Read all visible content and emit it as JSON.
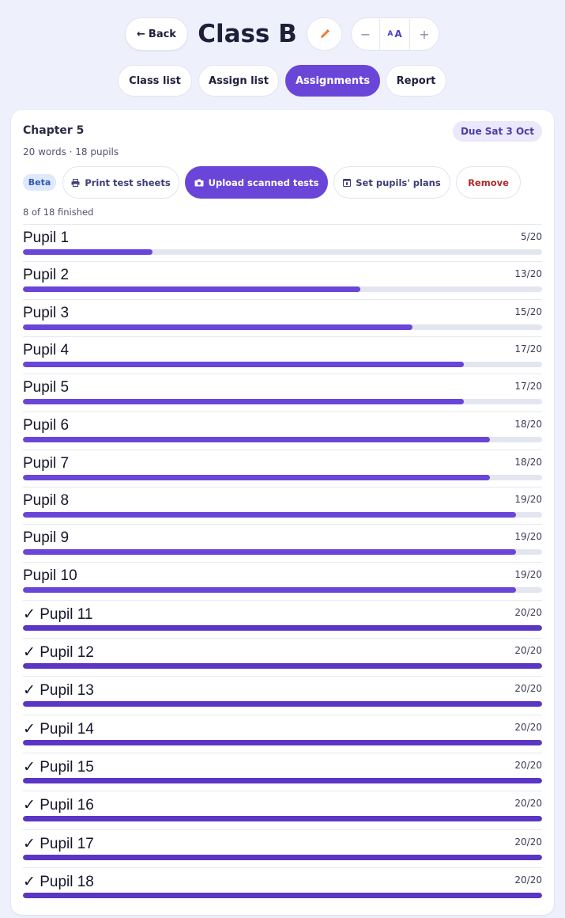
{
  "header": {
    "back_label": "Back",
    "back_arrow": "←",
    "title": "Class B",
    "edit_icon": "pencil-icon",
    "font_size_minus": "−",
    "font_size_small_a": "A",
    "font_size_big_a": "A",
    "font_size_plus": "+"
  },
  "tabs": [
    {
      "label": "Class list",
      "active": false
    },
    {
      "label": "Assign list",
      "active": false
    },
    {
      "label": "Assignments",
      "active": true
    },
    {
      "label": "Report",
      "active": false
    }
  ],
  "assignment": {
    "title": "Chapter 5",
    "due": "Due Sat 3 Oct",
    "meta": "20 words · 18 pupils",
    "beta_label": "Beta",
    "actions": {
      "print": "Print test sheets",
      "upload": "Upload scanned tests",
      "plans": "Set pupils' plans",
      "remove": "Remove"
    },
    "finished": "8 of 18 finished"
  },
  "pupils": [
    {
      "name": "Pupil 1",
      "score": "5/20",
      "correct": 5,
      "total": 20,
      "done": false
    },
    {
      "name": "Pupil 2",
      "score": "13/20",
      "correct": 13,
      "total": 20,
      "done": false
    },
    {
      "name": "Pupil 3",
      "score": "15/20",
      "correct": 15,
      "total": 20,
      "done": false
    },
    {
      "name": "Pupil 4",
      "score": "17/20",
      "correct": 17,
      "total": 20,
      "done": false
    },
    {
      "name": "Pupil 5",
      "score": "17/20",
      "correct": 17,
      "total": 20,
      "done": false
    },
    {
      "name": "Pupil 6",
      "score": "18/20",
      "correct": 18,
      "total": 20,
      "done": false
    },
    {
      "name": "Pupil 7",
      "score": "18/20",
      "correct": 18,
      "total": 20,
      "done": false
    },
    {
      "name": "Pupil 8",
      "score": "19/20",
      "correct": 19,
      "total": 20,
      "done": false
    },
    {
      "name": "Pupil 9",
      "score": "19/20",
      "correct": 19,
      "total": 20,
      "done": false
    },
    {
      "name": "Pupil 10",
      "score": "19/20",
      "correct": 19,
      "total": 20,
      "done": false
    },
    {
      "name": "✓ Pupil 11",
      "score": "20/20",
      "correct": 20,
      "total": 20,
      "done": true
    },
    {
      "name": "✓ Pupil 12",
      "score": "20/20",
      "correct": 20,
      "total": 20,
      "done": true
    },
    {
      "name": "✓ Pupil 13",
      "score": "20/20",
      "correct": 20,
      "total": 20,
      "done": true
    },
    {
      "name": "✓ Pupil 14",
      "score": "20/20",
      "correct": 20,
      "total": 20,
      "done": true
    },
    {
      "name": "✓ Pupil 15",
      "score": "20/20",
      "correct": 20,
      "total": 20,
      "done": true
    },
    {
      "name": "✓ Pupil 16",
      "score": "20/20",
      "correct": 20,
      "total": 20,
      "done": true
    },
    {
      "name": "✓ Pupil 17",
      "score": "20/20",
      "correct": 20,
      "total": 20,
      "done": true
    },
    {
      "name": "✓ Pupil 18",
      "score": "20/20",
      "correct": 20,
      "total": 20,
      "done": true
    }
  ],
  "colors": {
    "accent": "#6a46d8",
    "background": "#eef0fb",
    "danger": "#b02a2a"
  }
}
